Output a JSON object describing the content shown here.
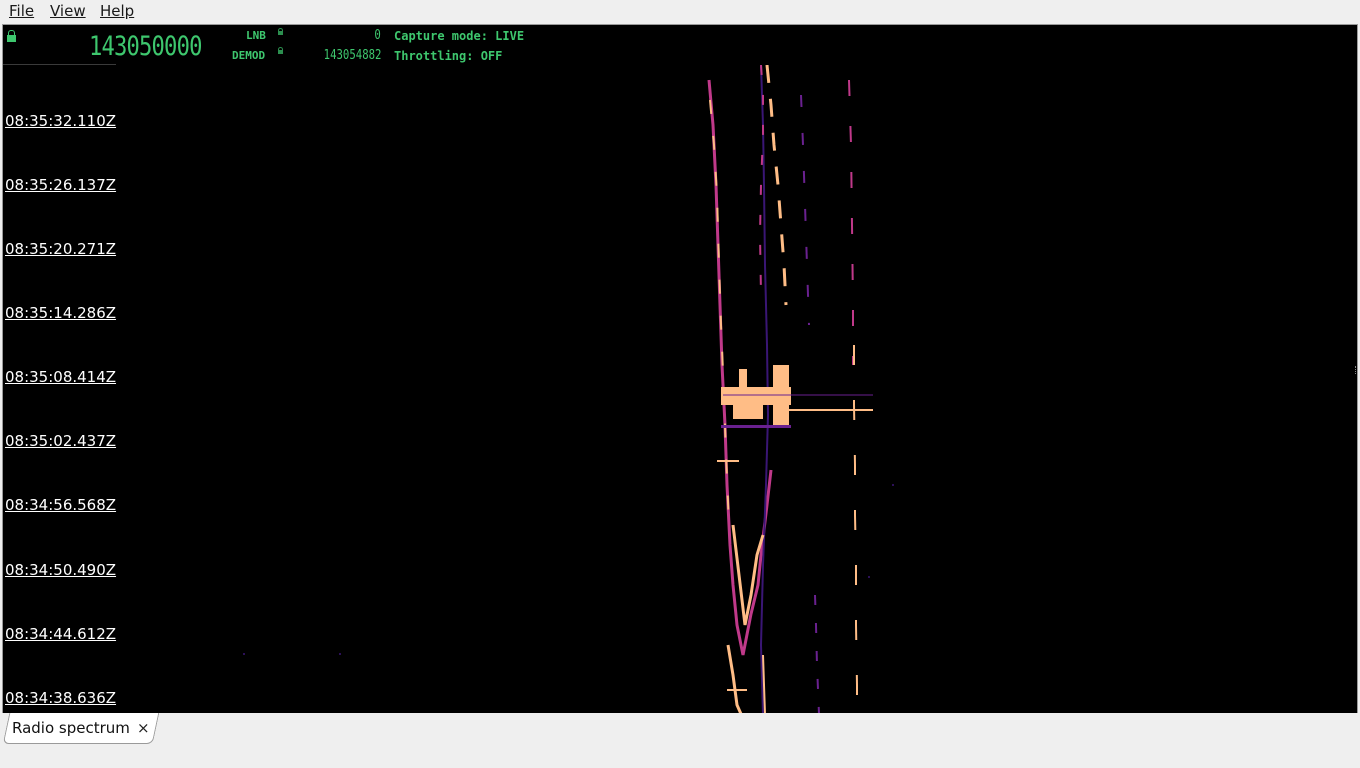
{
  "menu": {
    "file": "File",
    "view": "View",
    "help": "Help"
  },
  "header": {
    "main_frequency": "143050000",
    "lnb_label": "LNB",
    "lnb_value": "0",
    "demod_label": "DEMOD",
    "demod_value": "143054882",
    "capture_mode": "Capture mode: LIVE",
    "throttling": "Throttling: OFF",
    "accent_color": "#3ec76e"
  },
  "timestamps": [
    "08:35:32.110Z",
    "08:35:26.137Z",
    "08:35:20.271Z",
    "08:35:14.286Z",
    "08:35:08.414Z",
    "08:35:02.437Z",
    "08:34:56.568Z",
    "08:34:50.490Z",
    "08:34:44.612Z",
    "08:34:38.636Z"
  ],
  "tabs": [
    {
      "label": "Radio spectrum",
      "close": "×"
    }
  ],
  "colors": {
    "signal_hot": "#ffbd86",
    "signal_mid": "#c0398a",
    "signal_low": "#3a1675",
    "background": "#000000"
  }
}
